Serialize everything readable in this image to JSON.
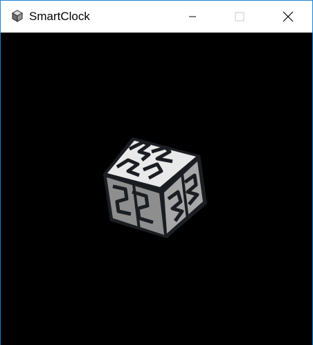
{
  "window": {
    "title": "SmartClock",
    "app_icon": "cube-icon",
    "caption_buttons": {
      "minimize": "minimize-icon",
      "maximize": "maximize-icon",
      "close": "close-icon"
    }
  },
  "colors": {
    "window_border": "#1883d7",
    "titlebar_bg": "#ffffff",
    "client_bg": "#000000",
    "cube_top": "#e8e8e8",
    "cube_left": "#8c8c8c",
    "cube_right": "#a6a6a6",
    "cube_edge": "#1a1e22"
  },
  "cube_digits": {
    "top": "24",
    "left": "22",
    "right": "32"
  }
}
